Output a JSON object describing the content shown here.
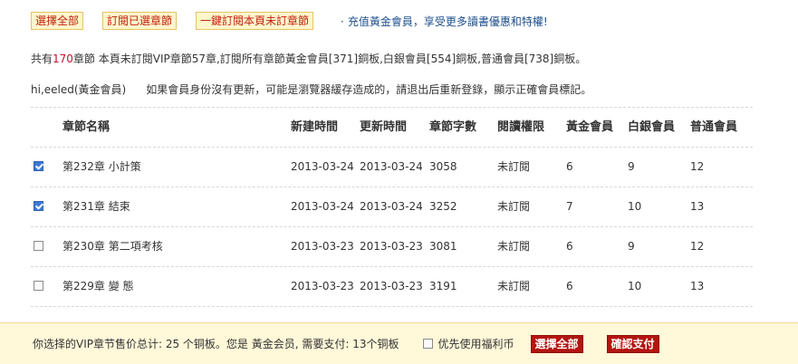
{
  "top": {
    "select_all": "選擇全部",
    "subscribe_selected": "訂閱已選章節",
    "subscribe_page": "一鍵訂閱本頁未訂章節",
    "promo": "充值黃金會員，享受更多讀書優惠和特權!"
  },
  "summary": {
    "prefix": "共有",
    "count": "170",
    "suffix": "章節 本頁未訂閱VIP章節57章,訂閱所有章節黃金會員[371]銅板,白銀會員[554]銅板,普通會員[738]銅板。"
  },
  "user": {
    "name": "hi,eeled(黃金會員)",
    "message": "如果會員身份沒有更新，可能是瀏覽器緩存造成的，請退出后重新登錄，顯示正確會員標記。"
  },
  "table": {
    "headers": [
      "章節名稱",
      "新建時間",
      "更新時間",
      "章節字數",
      "閱讀權限",
      "黃金會員",
      "白銀會員",
      "普通會員"
    ],
    "rows": [
      {
        "checked": true,
        "name": "第232章 小計策",
        "created": "2013-03-24",
        "updated": "2013-03-24",
        "words": "3058",
        "perm": "未訂閱",
        "gold": "6",
        "silver": "9",
        "normal": "12"
      },
      {
        "checked": true,
        "name": "第231章 結束",
        "created": "2013-03-24",
        "updated": "2013-03-24",
        "words": "3252",
        "perm": "未訂閱",
        "gold": "7",
        "silver": "10",
        "normal": "13"
      },
      {
        "checked": false,
        "name": "第230章 第二項考核",
        "created": "2013-03-23",
        "updated": "2013-03-23",
        "words": "3081",
        "perm": "未訂閱",
        "gold": "6",
        "silver": "9",
        "normal": "12"
      },
      {
        "checked": false,
        "name": "第229章 變 態",
        "created": "2013-03-23",
        "updated": "2013-03-23",
        "words": "3191",
        "perm": "未訂閱",
        "gold": "6",
        "silver": "10",
        "normal": "13"
      }
    ]
  },
  "bottom": {
    "total": "你选择的VIP章节售价总计: 25 个铜板。您是 黃金会员, 需要支付: 13个铜板",
    "prefer_label": "优先使用福利币",
    "select_all": "選擇全部",
    "confirm_pay": "確認支付"
  }
}
